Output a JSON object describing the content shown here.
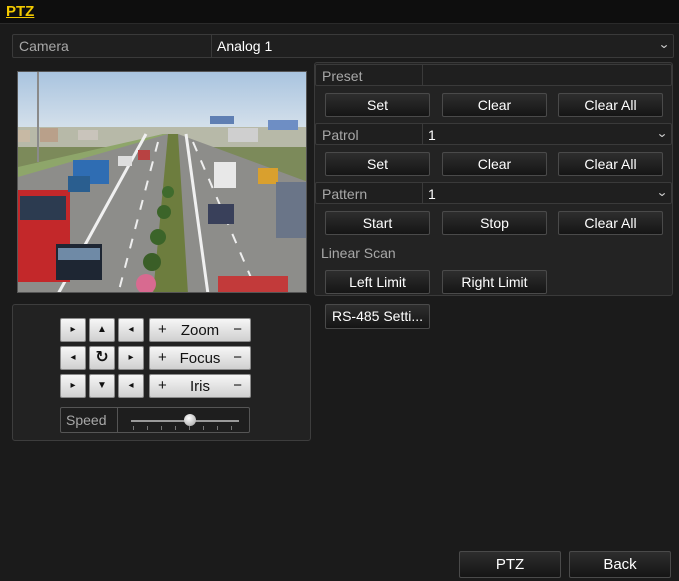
{
  "title": "PTZ",
  "camera": {
    "label": "Camera",
    "value": "Analog 1"
  },
  "preset": {
    "label": "Preset",
    "buttons": [
      "Set",
      "Clear",
      "Clear All"
    ]
  },
  "patrol": {
    "label": "Patrol",
    "value": "1",
    "buttons": [
      "Set",
      "Clear",
      "Clear All"
    ]
  },
  "pattern": {
    "label": "Pattern",
    "value": "1",
    "buttons": [
      "Start",
      "Stop",
      "Clear All"
    ]
  },
  "linear_scan": {
    "label": "Linear Scan",
    "left": "Left Limit",
    "right": "Right Limit"
  },
  "rs485": "RS-485 Setti...",
  "ptz_controls": {
    "zoom": "Zoom",
    "focus": "Focus",
    "iris": "Iris",
    "plus": "+",
    "minus": "−",
    "speed_label": "Speed",
    "speed_level": 0.55
  },
  "footer": {
    "ptz": "PTZ",
    "back": "Back"
  },
  "colors": {
    "title_accent": "#f2c900",
    "background": "#1b1b1b"
  }
}
